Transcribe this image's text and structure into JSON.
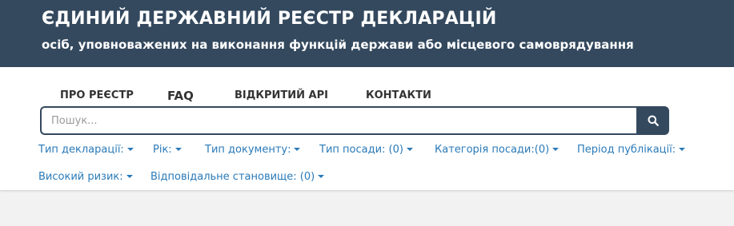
{
  "header": {
    "title": "ЄДИНИЙ ДЕРЖАВНИЙ РЕЄСТР ДЕКЛАРАЦІЙ",
    "subtitle": "осіб, уповноважених на виконання функцій держави або місцевого самоврядування"
  },
  "nav": {
    "about": "ПРО РЕЄСТР",
    "faq": "FAQ",
    "api": "ВІДКРИТИЙ API",
    "contacts": "КОНТАКТИ"
  },
  "search": {
    "placeholder": "Пошук...",
    "icon": "search-icon"
  },
  "filters": {
    "declaration_type": "Тип декларації:",
    "year": "Рік:",
    "document_type": "Тип документу:",
    "position_type": "Тип посади: (0)",
    "position_category": "Категорія посади:(0)",
    "publication_period": "Період публікації:",
    "high_risk": "Високий ризик:",
    "responsible_position": "Відповідальне становище: (0)"
  },
  "colors": {
    "header_bg": "#34495e",
    "link": "#2a7ab8",
    "page_bg": "#f2f2f2"
  }
}
